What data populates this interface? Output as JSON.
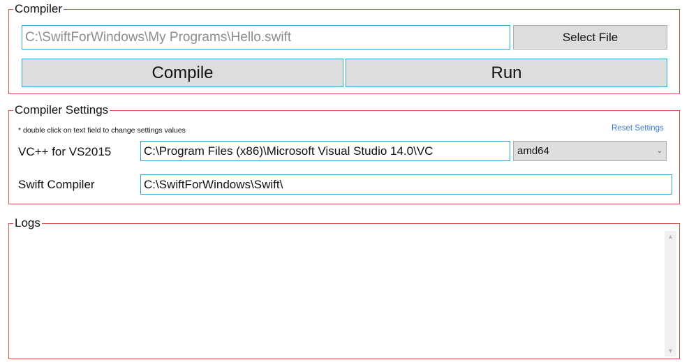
{
  "compiler": {
    "group_label": "Compiler",
    "file_path_value": "C:\\SwiftForWindows\\My Programs\\Hello.swift",
    "select_file_label": "Select File",
    "compile_label": "Compile",
    "run_label": "Run"
  },
  "settings": {
    "group_label": "Compiler Settings",
    "hint": "* double click on text field to change settings values",
    "reset_label": "Reset Settings",
    "vc_label": "VC++ for VS2015",
    "vc_path": "C:\\Program Files (x86)\\Microsoft Visual Studio 14.0\\VC",
    "arch_selected": "amd64",
    "swift_label": "Swift Compiler",
    "swift_path": "C:\\SwiftForWindows\\Swift\\"
  },
  "logs": {
    "group_label": "Logs",
    "content": ""
  },
  "icons": {
    "chevron": "chevron-down-icon",
    "scroll_up": "scroll-up-icon",
    "scroll_down": "scroll-down-icon"
  },
  "colors": {
    "group_border": "#d9534f",
    "field_border": "#3aa0c9",
    "button_bg": "#dddddd",
    "link": "#3a7bd5"
  }
}
